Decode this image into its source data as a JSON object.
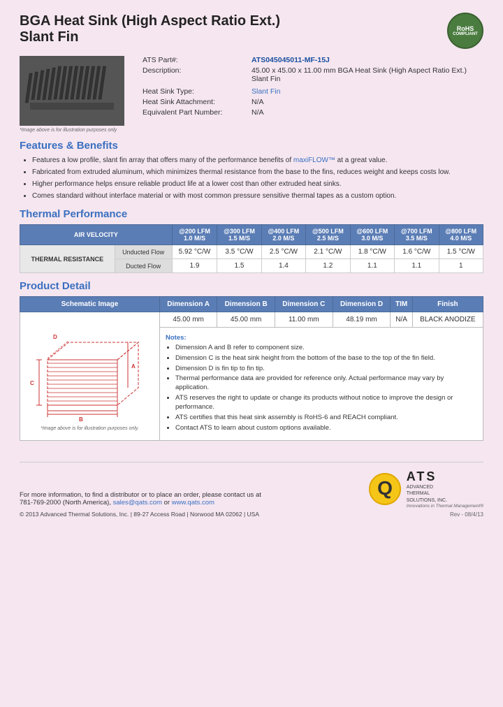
{
  "header": {
    "title_line1": "BGA Heat Sink (High Aspect Ratio Ext.)",
    "title_line2": "Slant Fin",
    "rohs": "RoHS\nCOMPLIANT"
  },
  "specs": {
    "part_label": "ATS Part#:",
    "part_value": "ATS045045011-MF-15J",
    "description_label": "Description:",
    "description_value": "45.00 x 45.00 x 11.00 mm  BGA Heat Sink (High Aspect Ratio Ext.) Slant Fin",
    "type_label": "Heat Sink Type:",
    "type_value": "Slant Fin",
    "attachment_label": "Heat Sink Attachment:",
    "attachment_value": "N/A",
    "equiv_label": "Equivalent Part Number:",
    "equiv_value": "N/A"
  },
  "image_caption": "*Image above is for illustration purposes only",
  "features_title": "Features & Benefits",
  "features": [
    "Features a low profile, slant fin array that offers many of the performance benefits of maxiFLOW™ at a great value.",
    "Fabricated from extruded aluminum, which minimizes thermal resistance from the base to the fins, reduces weight and keeps costs low.",
    "Higher performance helps ensure reliable product life at a lower cost than other extruded heat sinks.",
    "Comes standard without interface material or with most common pressure sensitive thermal tapes as a custom option."
  ],
  "thermal_title": "Thermal Performance",
  "thermal_table": {
    "col_headers": [
      "AIR VELOCITY",
      "@200 LFM\n1.0 M/S",
      "@300 LFM\n1.5 M/S",
      "@400 LFM\n2.0 M/S",
      "@500 LFM\n2.5 M/S",
      "@600 LFM\n3.0 M/S",
      "@700 LFM\n3.5 M/S",
      "@800 LFM\n4.0 M/S"
    ],
    "row_label": "THERMAL RESISTANCE",
    "rows": [
      {
        "type": "Unducted Flow",
        "values": [
          "5.92 °C/W",
          "3.5 °C/W",
          "2.5 °C/W",
          "2.1 °C/W",
          "1.8 °C/W",
          "1.6 °C/W",
          "1.5 °C/W"
        ]
      },
      {
        "type": "Ducted Flow",
        "values": [
          "1.9",
          "1.5",
          "1.4",
          "1.2",
          "1.1",
          "1.1",
          "1"
        ]
      }
    ]
  },
  "product_detail_title": "Product Detail",
  "detail_table": {
    "headers": [
      "Schematic Image",
      "Dimension A",
      "Dimension B",
      "Dimension C",
      "Dimension D",
      "TIM",
      "Finish"
    ],
    "values": [
      "45.00 mm",
      "45.00 mm",
      "11.00 mm",
      "48.19 mm",
      "N/A",
      "BLACK ANODIZE"
    ]
  },
  "notes": {
    "title": "Notes:",
    "items": [
      "Dimension A and B refer to component size.",
      "Dimension C is the heat sink height from the bottom of the base to the top of the fin field.",
      "Dimension D is fin tip to fin tip.",
      "Thermal performance data are provided for reference only. Actual performance may vary by application.",
      "ATS reserves the right to update or change its products without notice to improve the design or performance.",
      "ATS certifies that this heat sink assembly is RoHS-6 and REACH compliant.",
      "Contact ATS to learn about custom options available."
    ]
  },
  "schematic_caption": "*Image above is for illustration purposes only.",
  "footer": {
    "contact_text": "For more information, to find a distributor or to place an order, please contact us at",
    "phone": "781-769-2000 (North America),",
    "email": "sales@qats.com",
    "or": "or",
    "website": "www.qats.com",
    "copyright": "© 2013 Advanced Thermal Solutions, Inc.  |  89-27 Access Road  |  Norwood MA  02062  |  USA",
    "ats_name": "ATS",
    "ats_full": "ADVANCED\nTHERMAL\nSOLUTIONS, INC.",
    "ats_tagline": "Innovations in Thermal Management®",
    "rev": "Rev - 08/4/13"
  }
}
